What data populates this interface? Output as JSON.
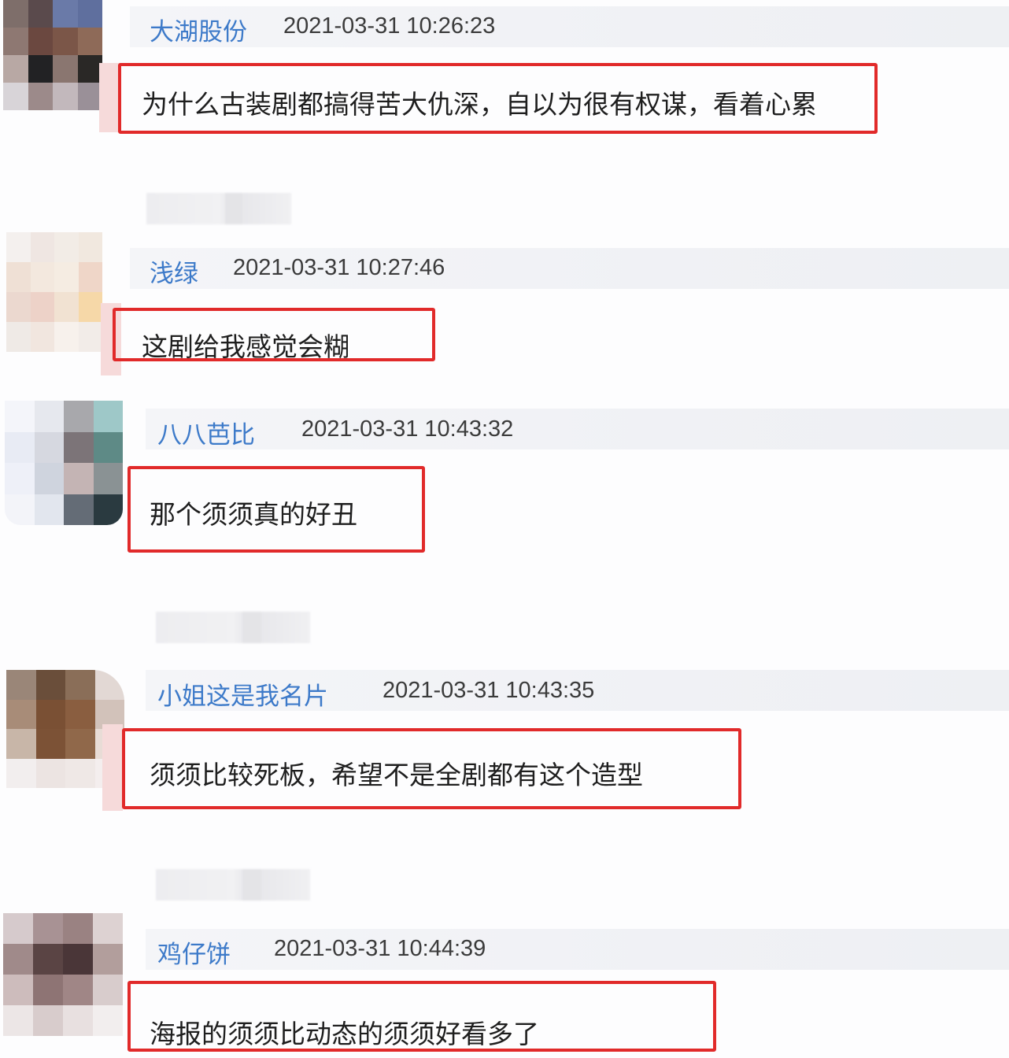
{
  "comments": [
    {
      "username": "大湖股份",
      "timestamp": "2021-03-31 10:26:23",
      "text": "为什么古装剧都搞得苦大仇深，自以为很有权谋，看着心累"
    },
    {
      "username": "浅绿",
      "timestamp": "2021-03-31 10:27:46",
      "text": "这剧给我感觉会糊"
    },
    {
      "username": "八八芭比",
      "timestamp": "2021-03-31 10:43:32",
      "text": "那个须须真的好丑"
    },
    {
      "username": "小姐这是我名片",
      "timestamp": "2021-03-31 10:43:35",
      "text": "须须比较死板，希望不是全剧都有这个造型"
    },
    {
      "username": "鸡仔饼",
      "timestamp": "2021-03-31 10:44:39",
      "text": "海报的须须比动态的须须好看多了"
    }
  ],
  "colors": {
    "username": "#3d7ac9",
    "highlight_border": "#e12a2a",
    "header_bar": "#f1f2f6"
  }
}
